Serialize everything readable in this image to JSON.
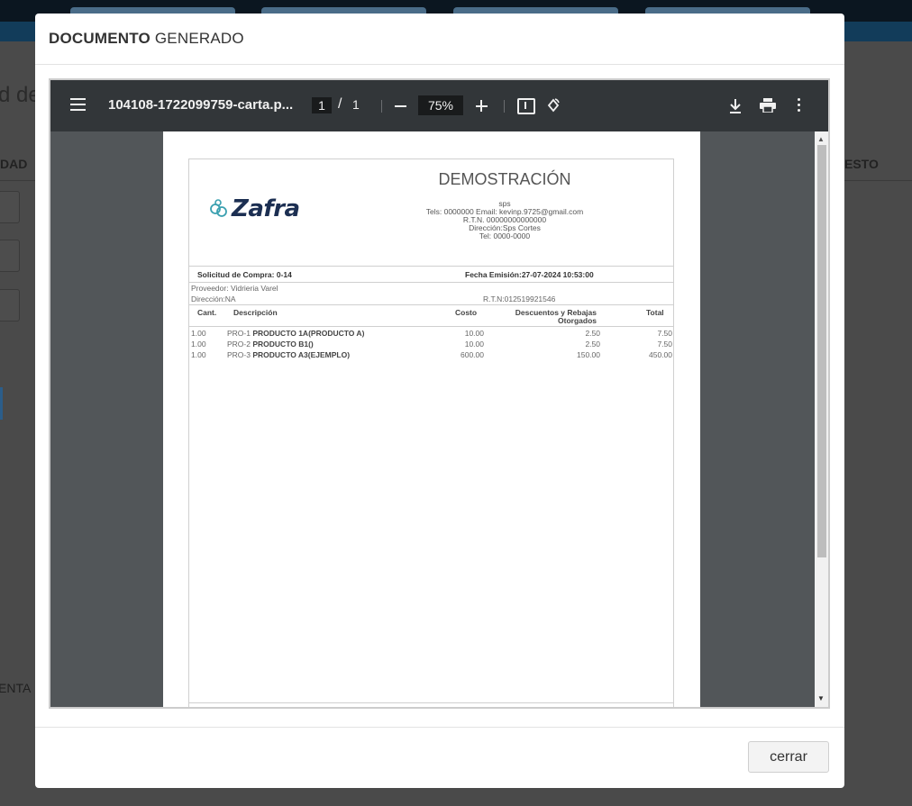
{
  "background": {
    "partial_title": "d de",
    "col_left": "DAD",
    "col_right": "ESTO",
    "partial_label": "ENTA"
  },
  "modal": {
    "title_bold": "DOCUMENTO",
    "title_rest": "GENERADO",
    "close_label": "cerrar"
  },
  "viewer": {
    "filename": "104108-1722099759-carta.p...",
    "page_current": "1",
    "page_separator": "/",
    "page_total": "1",
    "zoom": "75%"
  },
  "document": {
    "company": "DEMOSTRACIÓN",
    "logo_text": "Zafra",
    "company_lines": [
      "sps",
      "Tels: 0000000 Email: kevinp.9725@gmail.com",
      "R.T.N. 00000000000000",
      "Dirección:Sps Cortes",
      "Tel: 0000-0000"
    ],
    "request_label": "Solicitud de Compra: 0-14",
    "date_label": "Fecha Emisión:27-07-2024 10:53:00",
    "supplier": "Proveedor: Vidrieria Varel",
    "address": "Dirección:NA",
    "rtn": "R.T.N:012519921546",
    "columns": {
      "qty": "Cant.",
      "desc": "Descripción",
      "cost": "Costo",
      "disc_line1": "Descuentos y Rebajas",
      "disc_line2": "Otorgados",
      "total": "Total"
    },
    "items": [
      {
        "qty": "1.00",
        "code": "PRO-1",
        "name": "PRODUCTO 1A(PRODUCTO A)",
        "cost": "10.00",
        "discount": "2.50",
        "total": "7.50"
      },
      {
        "qty": "1.00",
        "code": "PRO-2",
        "name": "PRODUCTO B1()",
        "cost": "10.00",
        "discount": "2.50",
        "total": "7.50"
      },
      {
        "qty": "1.00",
        "code": "PRO-3",
        "name": "PRODUCTO A3(EJEMPLO)",
        "cost": "600.00",
        "discount": "150.00",
        "total": "450.00"
      }
    ]
  }
}
